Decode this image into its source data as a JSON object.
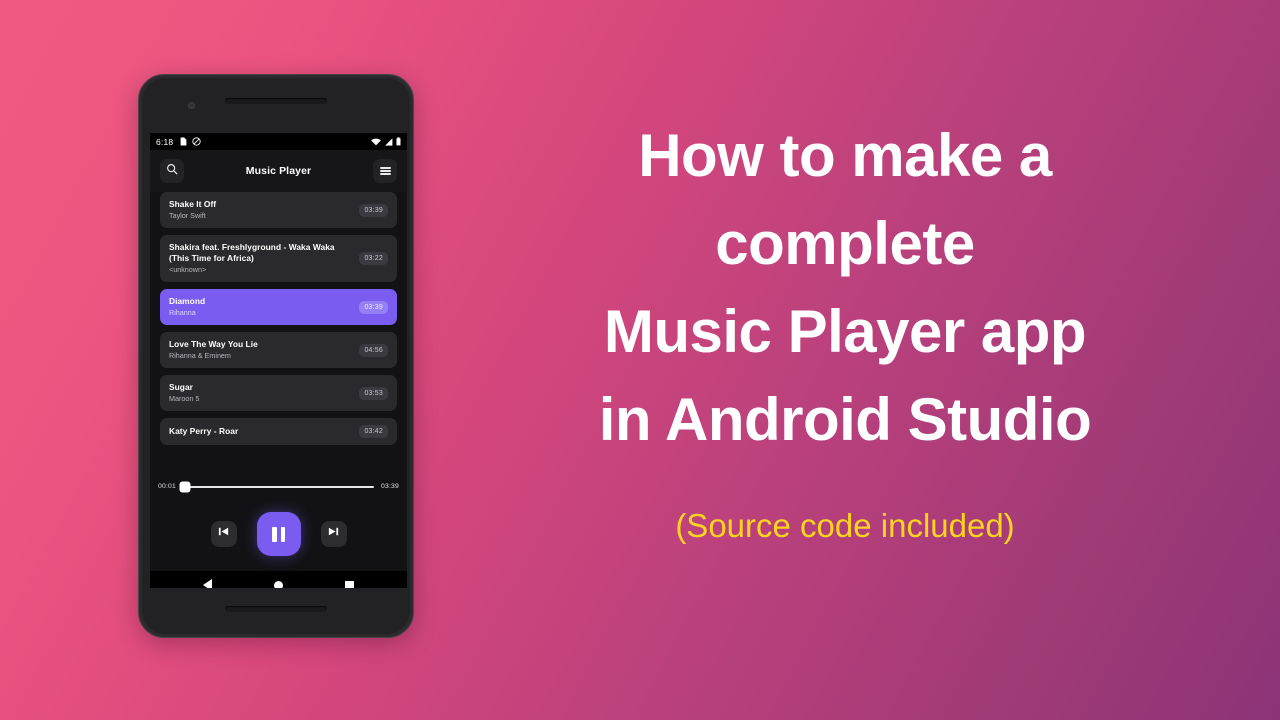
{
  "background": {
    "gradient_from": "#ef5b80",
    "gradient_to": "#8d3378"
  },
  "promo": {
    "headline_line1": "How to make a",
    "headline_line2": "complete",
    "headline_line3": "Music Player app",
    "headline_line4": "in Android Studio",
    "subtitle": "(Source code included)",
    "headline_color": "#ffffff",
    "subtitle_color": "#fcd420"
  },
  "phone": {
    "status_bar": {
      "clock": "6:18",
      "left_icons": [
        "sim-card-icon",
        "do-not-disturb-icon"
      ],
      "right_icons": [
        "wifi-icon",
        "cellular-signal-icon",
        "battery-icon"
      ]
    },
    "app_bar": {
      "title": "Music Player",
      "search_icon": "search-icon",
      "menu_icon": "hamburger-menu-icon"
    },
    "songs": [
      {
        "title": "Shake It Off",
        "artist": "Taylor Swift",
        "duration": "03:39",
        "selected": false
      },
      {
        "title": "Shakira feat. Freshlyground - Waka Waka (This Time for Africa)",
        "artist": "<unknown>",
        "duration": "03:22",
        "selected": false
      },
      {
        "title": "Diamond",
        "artist": "Rihanna",
        "duration": "03:39",
        "selected": true
      },
      {
        "title": "Love The Way You Lie",
        "artist": "Rihanna & Eminem",
        "duration": "04:56",
        "selected": false
      },
      {
        "title": "Sugar",
        "artist": "Maroon 5",
        "duration": "03:53",
        "selected": false
      },
      {
        "title": "Katy Perry - Roar",
        "artist": "",
        "duration": "03:42",
        "selected": false
      }
    ],
    "seek": {
      "elapsed": "00:01",
      "total": "03:39",
      "progress_percent": 1
    },
    "controls": {
      "previous_label": "previous-track",
      "play_pause_label": "pause",
      "next_label": "next-track",
      "accent_color": "#7b5cf0",
      "state": "playing"
    },
    "nav_bar": {
      "back": "back-button",
      "home": "home-button",
      "recents": "recents-button"
    }
  }
}
